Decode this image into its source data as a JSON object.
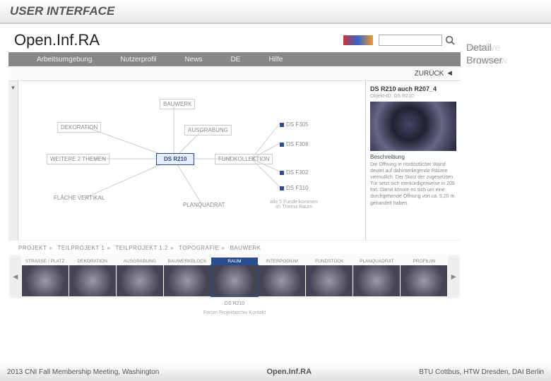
{
  "slide": {
    "header": "USER INTERFACE",
    "footer_left": "2013 CNI Fall Membership Meeting, Washington",
    "footer_center": "Open.Inf.RA",
    "footer_right": "BTU Cottbus, HTW Dresden, DAI Berlin"
  },
  "side_label": {
    "ghost1": "Intuitive",
    "ghost2": "Overview",
    "front1": "Detail",
    "front2": "Browser"
  },
  "app": {
    "title": "Open.Inf.RA",
    "search_placeholder": " ",
    "nav": [
      "Arbeitsumgebung",
      "Nutzerprofil",
      "News",
      "DE",
      "Hilfe"
    ],
    "back": "ZURÜCK",
    "back_arrow": "◄"
  },
  "graph": {
    "central": "DS R210",
    "top": "BAUWERK",
    "left": [
      "DEKORATION",
      "WEITERE 2 THEMEN",
      "FLÄCHE VERTIKAL"
    ],
    "mid_upper": "AUSGRABUNG",
    "right_label": "FUNDKOLLEKTION",
    "right_items": [
      "DS F305",
      "DS F308",
      "DS F302",
      "DS F310"
    ],
    "bottom": "PLANQUADRAT",
    "note": "alle 5 Funde kommen im Thema Raum"
  },
  "detail": {
    "title": "DS R210 auch R207_4",
    "sub": "Objekt-ID: DS R210",
    "label": "Beschreibung",
    "text": "Die Öffnung in nordöstlicher Wand deutet auf dahinterliegende Räume vermutlich. Der Sturz der zugesetzten Tür setzt sich merkürdigerweise in 209 fort. Damit könnte es sich um eine durchgehende Öffnung von ca. 5,20 m gehandelt haben."
  },
  "breadcrumb": [
    "PROJEKT",
    "TEILPROJEKT 1",
    "TEILPROJEKT 1.2",
    "TOPOGRAFIE",
    "BAUWERK"
  ],
  "thumbs": [
    {
      "label": "STRASSE / PLATZ",
      "active": false
    },
    {
      "label": "DEKORATION",
      "active": false
    },
    {
      "label": "AUSGRABUNG",
      "active": false
    },
    {
      "label": "BAUWERKBLOCK",
      "active": false
    },
    {
      "label": "RAUM",
      "active": true
    },
    {
      "label": "INTERPODIUM",
      "active": false
    },
    {
      "label": "FUNDSTÜCK",
      "active": false
    },
    {
      "label": "PLANQUADRAT",
      "active": false
    },
    {
      "label": "PROFIL/IN",
      "active": false
    }
  ],
  "thumb_caption": "DS R210",
  "app_footer": "Forum    Projektarchiv    Kontakt"
}
